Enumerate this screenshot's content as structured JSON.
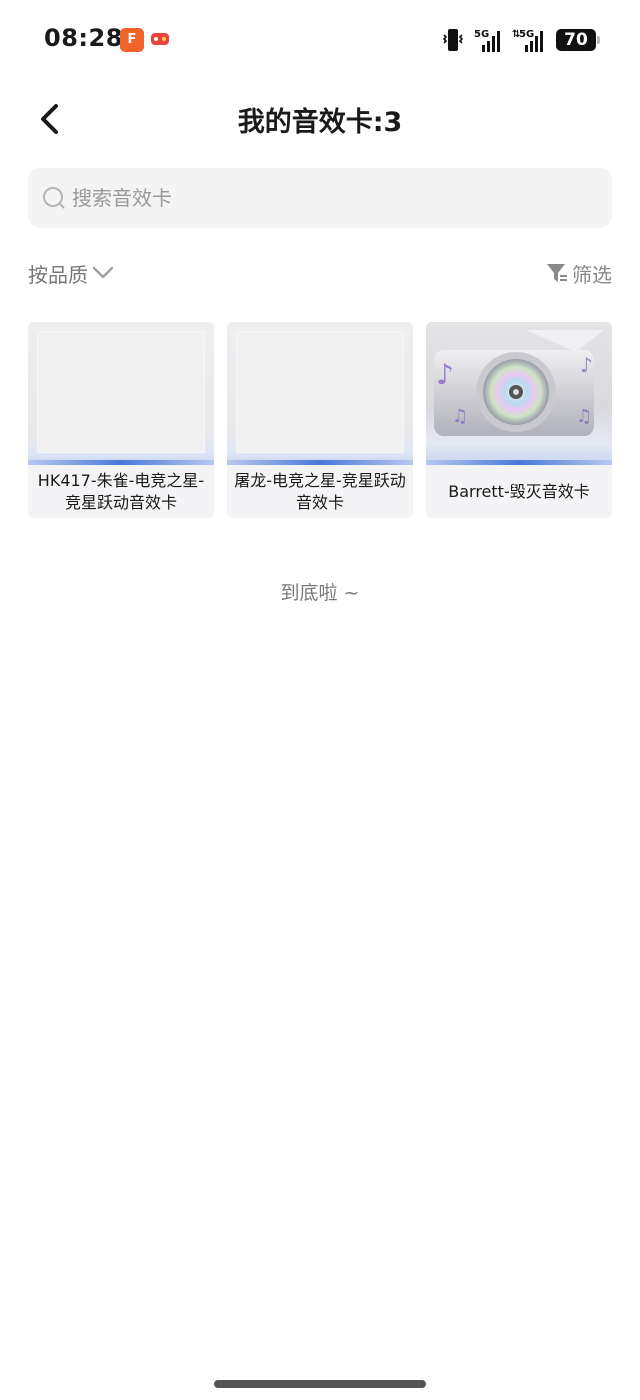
{
  "status_bar": {
    "time": "08:28",
    "app_icons": [
      "cf-app-icon",
      "game-app-icon"
    ],
    "signal_1_label": "5G",
    "signal_2_label": "5G",
    "battery": "70"
  },
  "header": {
    "title": "我的音效卡:3",
    "back_icon": "chevron-left-icon"
  },
  "search": {
    "placeholder": "搜索音效卡",
    "value": ""
  },
  "toolbar": {
    "sort_label": "按品质",
    "filter_label": "筛选"
  },
  "cards": [
    {
      "label": "HK417-朱雀-电竞之星-竞星跃动音效卡"
    },
    {
      "label": "屠龙-电竞之星-竞星跃动音效卡"
    },
    {
      "label": "Barrett-毁灭音效卡"
    }
  ],
  "list_end_text": "到底啦 ~",
  "colors": {
    "accent_blue": "#4a78d9",
    "card_bg": "#f4f4f6",
    "search_bg": "#f4f4f5"
  }
}
